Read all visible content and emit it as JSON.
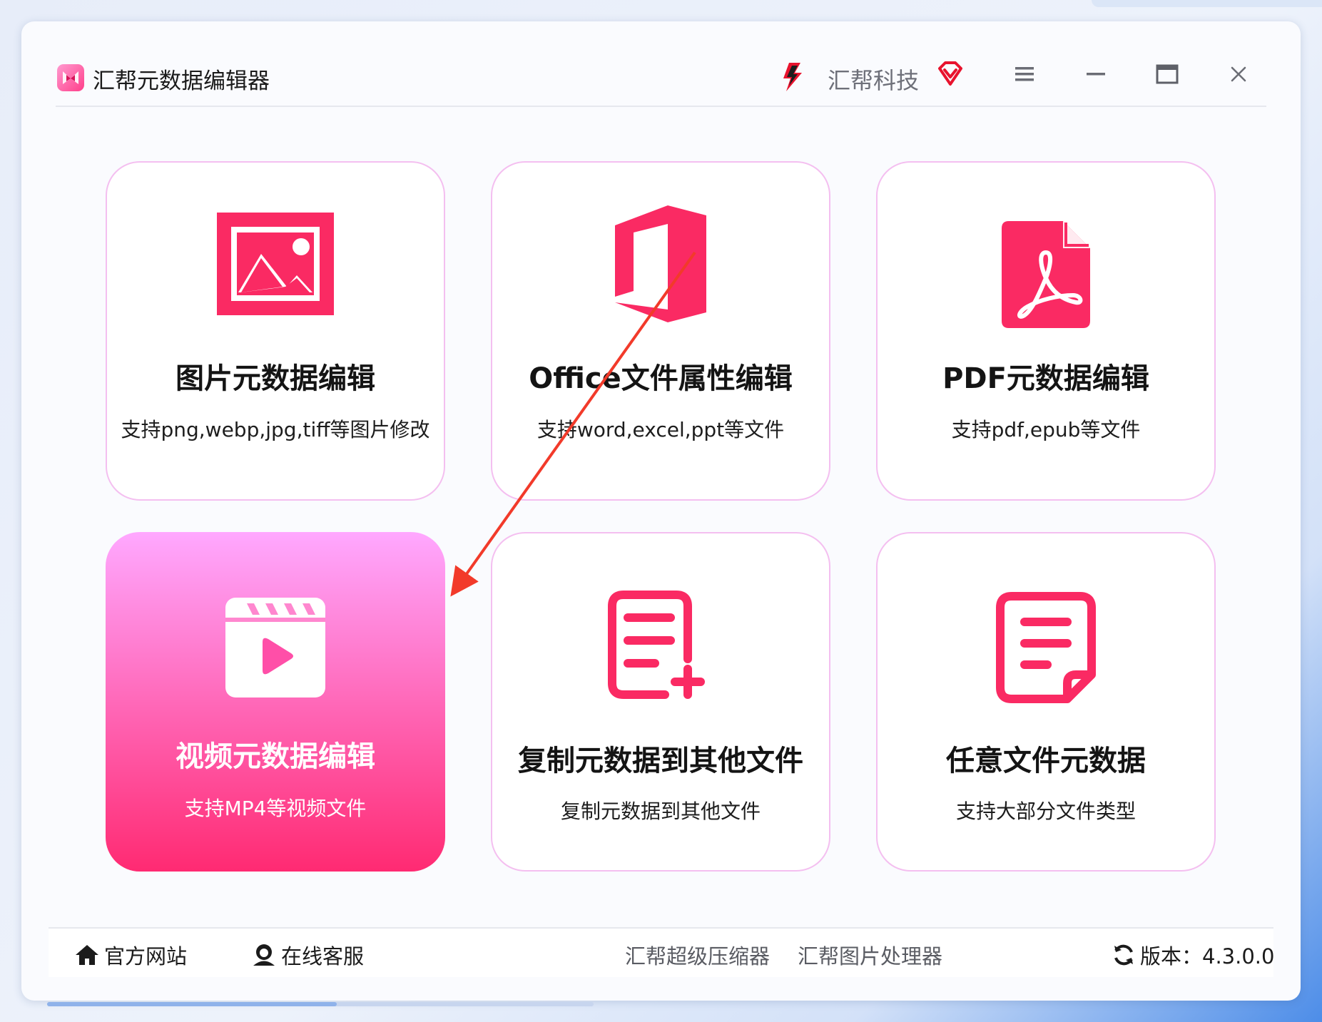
{
  "app": {
    "title": "汇帮元数据编辑器",
    "brand_name": "汇帮科技"
  },
  "window_controls": {
    "menu_icon": "hamburger-menu-icon",
    "minimize_icon": "minimize-icon",
    "maximize_icon": "maximize-icon",
    "close_icon": "close-icon"
  },
  "cards": [
    {
      "title": "图片元数据编辑",
      "subtitle": "支持png,webp,jpg,tiff等图片修改",
      "icon": "image-icon"
    },
    {
      "title": "Office文件属性编辑",
      "subtitle": "支持word,excel,ppt等文件",
      "icon": "office-icon"
    },
    {
      "title": "PDF元数据编辑",
      "subtitle": "支持pdf,epub等文件",
      "icon": "pdf-icon"
    },
    {
      "title": "视频元数据编辑",
      "subtitle": "支持MP4等视频文件",
      "icon": "video-icon",
      "active": true
    },
    {
      "title": "复制元数据到其他文件",
      "subtitle": "复制元数据到其他文件",
      "icon": "document-add-icon"
    },
    {
      "title": "任意文件元数据",
      "subtitle": "支持大部分文件类型",
      "icon": "document-icon"
    }
  ],
  "footer": {
    "official_site": "官方网站",
    "online_service": "在线客服",
    "compressor": "汇帮超级压缩器",
    "image_processor": "汇帮图片处理器",
    "version": "版本：4.3.0.0"
  },
  "progress": {
    "fraction": 0.53
  },
  "colors": {
    "accent": "#ff2a6b",
    "card_border": "#f4bff0",
    "active_top": "#ffa8ff",
    "active_bottom": "#ff2a72",
    "annotation_arrow": "#f23a2a"
  }
}
